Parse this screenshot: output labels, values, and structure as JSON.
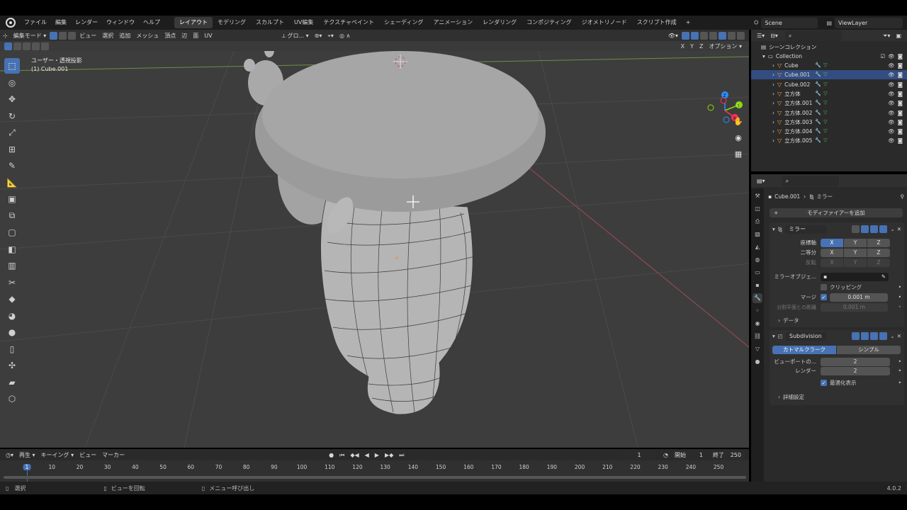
{
  "menubar": {
    "menus": [
      "ファイル",
      "編集",
      "レンダー",
      "ウィンドウ",
      "ヘルプ"
    ],
    "workspaces": [
      "レイアウト",
      "モデリング",
      "スカルプト",
      "UV編集",
      "テクスチャペイント",
      "シェーディング",
      "アニメーション",
      "レンダリング",
      "コンポジティング",
      "ジオメトリノード",
      "スクリプト作成"
    ],
    "active_workspace": "レイアウト",
    "scene": "Scene",
    "view_layer": "ViewLayer"
  },
  "viewport": {
    "mode": "編集モード",
    "menus": [
      "ビュー",
      "選択",
      "追加",
      "メッシュ",
      "頂点",
      "辺",
      "面",
      "UV"
    ],
    "transform_orientation": "グロ...",
    "axes": [
      "X",
      "Y",
      "Z"
    ],
    "options_label": "オプション",
    "info_line1": "ユーザー・透視投影",
    "info_line2": "(1) Cube.001",
    "gizmo_axes": [
      "X",
      "Y",
      "Z"
    ]
  },
  "timeline": {
    "menus": [
      "再生",
      "キーイング",
      "ビュー",
      "マーカー"
    ],
    "current_frame": "1",
    "start_label": "開始",
    "start_value": "1",
    "end_label": "終了",
    "end_value": "250",
    "ruler_ticks": [
      "1",
      "10",
      "20",
      "30",
      "40",
      "50",
      "60",
      "70",
      "80",
      "90",
      "100",
      "110",
      "120",
      "130",
      "140",
      "150",
      "160",
      "170",
      "180",
      "190",
      "200",
      "210",
      "220",
      "230",
      "240",
      "250"
    ],
    "ruler_values": [
      1,
      10,
      20,
      30,
      40,
      50,
      60,
      70,
      80,
      90,
      100,
      110,
      120,
      130,
      140,
      150,
      160,
      170,
      180,
      190,
      200,
      210,
      220,
      230,
      240,
      250
    ]
  },
  "statusbar": {
    "select": "選択",
    "rotate": "ビューを回転",
    "menu": "メニュー呼び出し",
    "version": "4.0.2"
  },
  "outliner": {
    "scene_collection": "シーンコレクション",
    "collection": "Collection",
    "items": [
      "Cube",
      "Cube.001",
      "Cube.002",
      "立方体",
      "立方体.001",
      "立方体.002",
      "立方体.003",
      "立方体.004",
      "立方体.005"
    ],
    "selected": "Cube.001"
  },
  "properties": {
    "breadcrumb_object": "Cube.001",
    "breadcrumb_modifier": "ミラー",
    "add_modifier": "モディファイアーを追加",
    "mirror": {
      "name": "ミラー",
      "axis_label": "座標軸",
      "bisect_label": "二等分",
      "flip_label": "反転",
      "axes": [
        "X",
        "Y",
        "Z"
      ],
      "mirror_object_label": "ミラーオブジェ...",
      "clipping_label": "クリッピング",
      "merge_label": "マージ",
      "merge_value": "0.001 m",
      "bisect_distance_label": "分割平面との距離",
      "bisect_distance_value": "0.001 m",
      "data_label": "データ"
    },
    "subdivision": {
      "name": "Subdivision",
      "catmull_clark": "カトマルクラーク",
      "simple": "シンプル",
      "viewport_label": "ビューポートの...",
      "viewport_value": "2",
      "render_label": "レンダー",
      "render_value": "2",
      "optimal_display": "最適化表示",
      "advanced": "詳細設定"
    }
  }
}
